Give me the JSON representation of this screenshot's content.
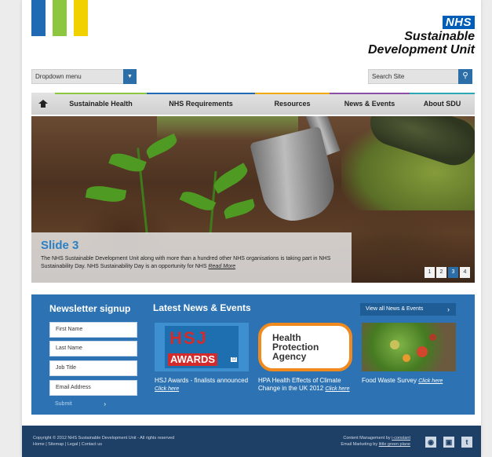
{
  "header": {
    "stripes": [
      "#1f6ab3",
      "#8dc63f",
      "#f2d100"
    ],
    "logo": {
      "mark": "NHS",
      "line1": "Sustainable",
      "line2": "Development Unit"
    },
    "dropdown": {
      "label": "Dropdown menu",
      "icon": "chevron-down-icon"
    },
    "search": {
      "placeholder": "Search Site",
      "icon": "search-icon"
    }
  },
  "nav": {
    "home_icon": "home-icon",
    "items": [
      {
        "label": "Sustainable Health",
        "color": "#8dc63f"
      },
      {
        "label": "NHS Requirements",
        "color": "#1f6ab3"
      },
      {
        "label": "Resources",
        "color": "#f2a900"
      },
      {
        "label": "News & Events",
        "color": "#8b4fa3"
      },
      {
        "label": "About SDU",
        "color": "#2aa8b6"
      }
    ]
  },
  "slider": {
    "title": "Slide 3",
    "text": "The NHS Sustainable Development Unit along with more than a hundred other NHS organisations is taking part in NHS Sustainability Day. NHS Sustainability Day is an opportunity for NHS",
    "read_more": "Read More",
    "pages": [
      "1",
      "2",
      "3",
      "4"
    ],
    "active_page": "3"
  },
  "newsletter": {
    "title": "Newsletter signup",
    "fields": [
      "First Name",
      "Last Name",
      "Job Title",
      "Email Address"
    ],
    "submit": "Submit"
  },
  "news": {
    "title": "Latest News & Events",
    "view_all": "View all News & Events",
    "items": [
      {
        "text": "HSJ Awards - finalists announced",
        "link": "Click here",
        "logo_top": "HSJ",
        "logo_bottom": "AWARDS",
        "logo_num": "12"
      },
      {
        "text": "HPA Health Effects of Climate Change in the UK 2012",
        "link": "Click here",
        "logo_l1": "Health",
        "logo_l2": "Protection",
        "logo_l3": "Agency"
      },
      {
        "text": "Food Waste Survey",
        "link": "Click here"
      }
    ]
  },
  "footer": {
    "left_l1": "Copyright © 2012 NHS Sustainable Development Unit - All rights reserved",
    "left_l2": "Home | Sitemap | Legal | Contact us",
    "right_l1": "Content Management by ",
    "right_l1_link": "i-constant",
    "right_l2": "Email Marketing by ",
    "right_l2_link": "little green plane",
    "social": [
      "rss-icon",
      "linkedin-icon",
      "twitter-icon"
    ]
  }
}
